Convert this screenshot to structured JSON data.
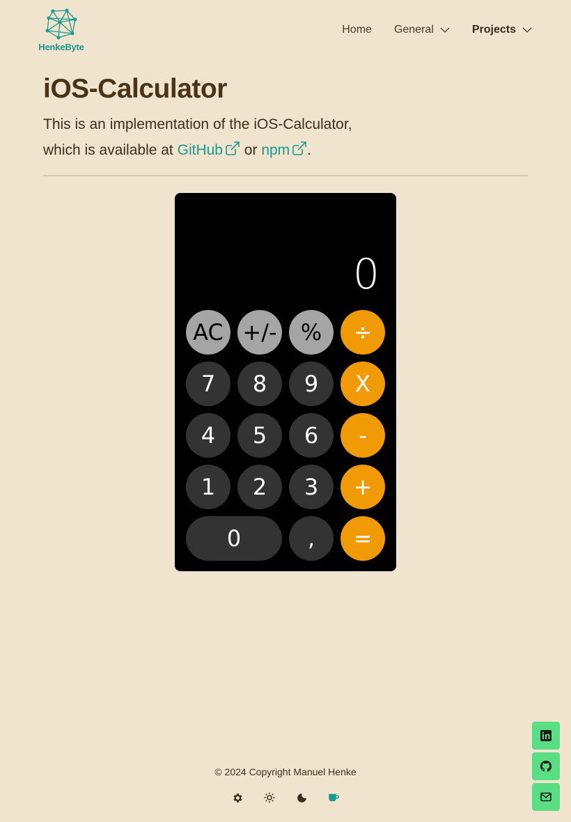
{
  "header": {
    "logo_text": "HenkeByte",
    "nav": [
      {
        "label": "Home"
      },
      {
        "label": "General"
      },
      {
        "label": "Projects"
      }
    ]
  },
  "main": {
    "title": "iOS-Calculator",
    "intro_line1": "This is an implementation of the iOS-Calculator,",
    "intro_prefix": "which is available at ",
    "link_github": "GitHub",
    "or_text": " or ",
    "link_npm": "npm",
    "period": "."
  },
  "calculator": {
    "display": "0",
    "keys": {
      "ac": "AC",
      "sign": "+/-",
      "percent": "%",
      "divide": "÷",
      "seven": "7",
      "eight": "8",
      "nine": "9",
      "multiply": "X",
      "four": "4",
      "five": "5",
      "six": "6",
      "minus": "-",
      "one": "1",
      "two": "2",
      "three": "3",
      "plus": "+",
      "zero": "0",
      "decimal": ",",
      "equals": "="
    },
    "colors": {
      "function": "#a5a5a5",
      "digit": "#333333",
      "operator": "#f09a06"
    }
  },
  "footer": {
    "copyright": "© 2024 Copyright Manuel Henke",
    "theme_icons": [
      "gear-icon",
      "sun-icon",
      "moon-icon",
      "coffee-icon"
    ]
  },
  "social": [
    "linkedin-icon",
    "github-icon",
    "mail-icon"
  ],
  "colors": {
    "background": "#f1e4cf",
    "accent": "#1a9a8f",
    "social": "#5ade84"
  }
}
